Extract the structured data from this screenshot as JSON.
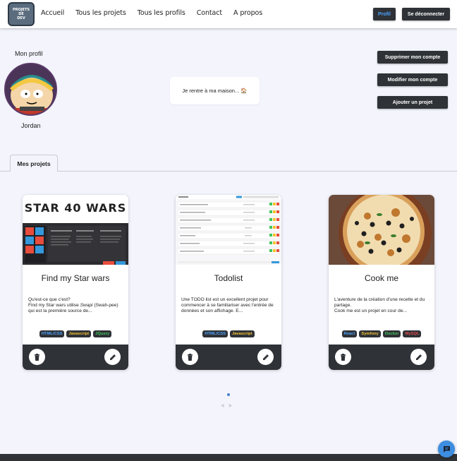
{
  "logo": {
    "lines": [
      "PROJETS",
      "DE",
      "DEV"
    ]
  },
  "nav": {
    "links": [
      "Accueil",
      "Tous les projets",
      "Tous les profils",
      "Contact",
      "A propos"
    ],
    "profil_label": "Profil",
    "logout_label": "Se déconnecter"
  },
  "profile": {
    "title": "Mon profil",
    "name": "Jordan",
    "status": "Je rentre à ma maison... 🏠",
    "actions": [
      "Supprimer mon compte",
      "Modifier mon compte",
      "Ajouter un projet"
    ]
  },
  "tabs": {
    "active": "Mes projets"
  },
  "projects": [
    {
      "title": "Find my Star wars",
      "desc_line1": "Qu'est-ce que c'est?",
      "desc_line2a": "Find my Star wars utilise ",
      "desc_italic": "Swapi",
      "desc_line2b": " (Swah-pee) qui est la première source de...",
      "image_caption": "STAR WARS",
      "tags": [
        {
          "label": "HTML/CSS",
          "color": "#4ba3ff"
        },
        {
          "label": "Javascript",
          "color": "#f2c230"
        },
        {
          "label": "JQuery",
          "color": "#3ec45a"
        }
      ]
    },
    {
      "title": "Todolist",
      "desc": "Une TODO list est un excellent projet pour commencer à se familiariser avec l'entrée de données et son affichage. E...",
      "tags": [
        {
          "label": "HTML/CSS",
          "color": "#4ba3ff"
        },
        {
          "label": "Javascript",
          "color": "#f2c230"
        }
      ]
    },
    {
      "title": "Cook me",
      "desc": "L'aventure de la création d'une recette et du partage.\nCook me est un projet en cour de...",
      "tags": [
        {
          "label": "React",
          "color": "#4ba3ff"
        },
        {
          "label": "Symfony",
          "color": "#f2c230"
        },
        {
          "label": "Docker",
          "color": "#3ec45a"
        },
        {
          "label": "MySQL",
          "color": "#e0474c"
        }
      ]
    }
  ],
  "pagination": {
    "prev": "<",
    "next": ">"
  },
  "colors": {
    "dark": "#2f3236",
    "accent": "#4ba3ff",
    "background": "#f3f4fc"
  }
}
